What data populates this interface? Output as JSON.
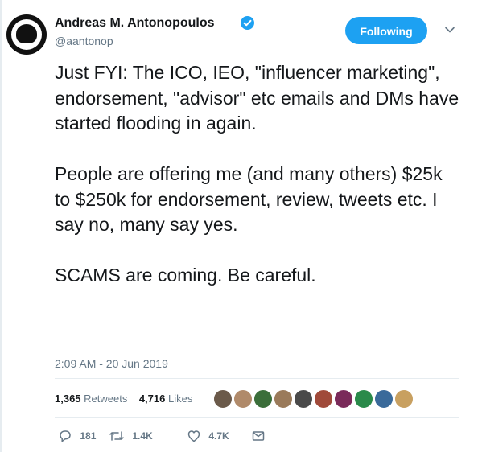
{
  "author": {
    "display_name": "Andreas M. Antonopoulos",
    "handle": "@aantonop",
    "verified": true
  },
  "follow_button": {
    "label": "Following"
  },
  "tweet": {
    "paragraphs": [
      "Just FYI: The ICO, IEO, \"influencer marketing\", endorsement, \"advisor\" etc emails and DMs have started flooding in again.",
      "People are offering me (and many others) $25k to $250k for endorsement, review, tweets etc. I say no, many say yes.",
      "SCAMS are coming. Be careful."
    ],
    "timestamp": "2:09 AM - 20 Jun 2019"
  },
  "stats": {
    "retweets_count": "1,365",
    "retweets_label": "Retweets",
    "likes_count": "4,716",
    "likes_label": "Likes"
  },
  "likers": [
    {
      "icon": "avatar-1",
      "color": "#6b5a4a"
    },
    {
      "icon": "avatar-2",
      "color": "#b08a6a"
    },
    {
      "icon": "avatar-3",
      "color": "#3b6e3a"
    },
    {
      "icon": "avatar-4",
      "color": "#9a7a5a"
    },
    {
      "icon": "avatar-5",
      "color": "#4a4a4a"
    },
    {
      "icon": "avatar-6",
      "color": "#a04a3a"
    },
    {
      "icon": "avatar-7",
      "color": "#7a2a5a"
    },
    {
      "icon": "avatar-8",
      "color": "#2a8a4a"
    },
    {
      "icon": "avatar-9",
      "color": "#3a6a9a"
    },
    {
      "icon": "avatar-10",
      "color": "#c8a060"
    }
  ],
  "actions": {
    "reply_count": "181",
    "retweet_count": "1.4K",
    "like_count": "4.7K"
  },
  "colors": {
    "brand_blue": "#1da1f2",
    "text": "#14171a",
    "muted": "#657786",
    "divider": "#e6ecf0"
  }
}
